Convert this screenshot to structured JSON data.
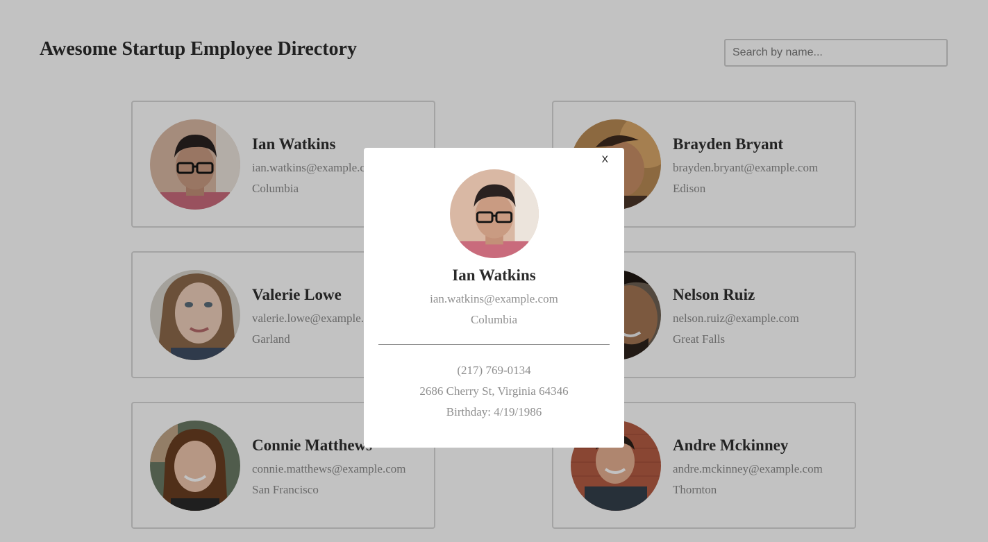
{
  "header": {
    "title": "Awesome Startup Employee Directory"
  },
  "search": {
    "placeholder": "Search by name..."
  },
  "employees": [
    {
      "name": "Ian Watkins",
      "email": "ian.watkins@example.com",
      "city": "Columbia"
    },
    {
      "name": "Brayden Bryant",
      "email": "brayden.bryant@example.com",
      "city": "Edison"
    },
    {
      "name": "Valerie Lowe",
      "email": "valerie.lowe@example.com",
      "city": "Garland"
    },
    {
      "name": "Nelson Ruiz",
      "email": "nelson.ruiz@example.com",
      "city": "Great Falls"
    },
    {
      "name": "Connie Matthews",
      "email": "connie.matthews@example.com",
      "city": "San Francisco"
    },
    {
      "name": "Andre Mckinney",
      "email": "andre.mckinney@example.com",
      "city": "Thornton"
    }
  ],
  "modal": {
    "close_label": "X",
    "name": "Ian Watkins",
    "email": "ian.watkins@example.com",
    "city": "Columbia",
    "phone": "(217) 769-0134",
    "address": "2686 Cherry St, Virginia 64346",
    "birthday": "Birthday: 4/19/1986"
  },
  "colors": {
    "overlay": "rgba(0,0,0,0.24)",
    "name_text": "#2e2e2e",
    "secondary_text": "#8a8a8a"
  }
}
